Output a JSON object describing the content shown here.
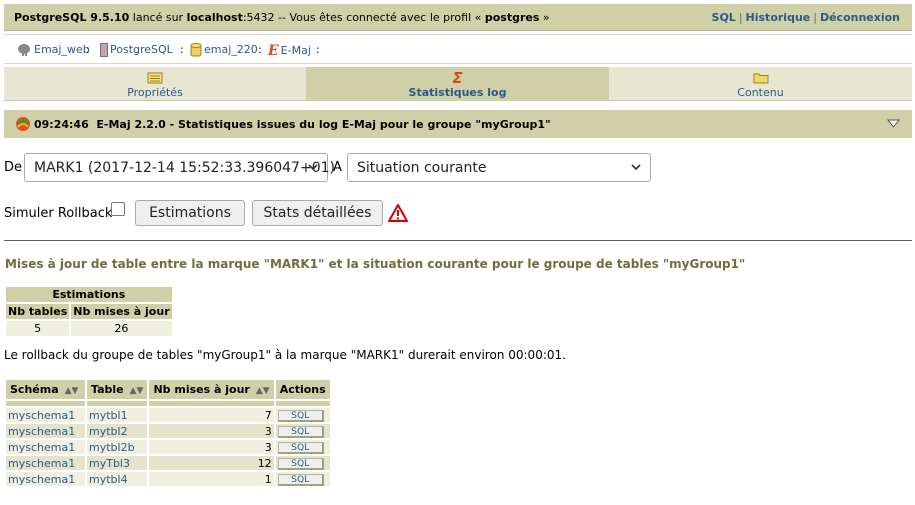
{
  "topbar": {
    "server_name": "PostgreSQL 9.5.10",
    "launched_on": " lancé sur ",
    "host": "localhost",
    "port_msg": ":5432 -- Vous êtes connecté avec le profil « ",
    "profile": "postgres",
    "close_quote": " »",
    "links": {
      "sql": "SQL",
      "history": "Historique",
      "logout": "Déconnexion"
    }
  },
  "breadcrumb": {
    "server": "Emaj_web",
    "engine": "PostgreSQL",
    "database": "emaj_220",
    "plugin": "E-Maj",
    "sep": ":"
  },
  "tabs": [
    {
      "label": "Propriétés"
    },
    {
      "label": "Statistiques log"
    },
    {
      "label": "Contenu"
    }
  ],
  "title": {
    "time": "09:24:46",
    "text": "E-Maj 2.2.0  -  Statistiques issues du log E-Maj pour le groupe \"myGroup1\""
  },
  "form": {
    "from_label": "De",
    "from_value": "MARK1 (2017-12-14 15:52:33.396047+01)",
    "to_label": "A",
    "to_value": "Situation courante",
    "simulate_label": "Simuler Rollback",
    "estimations_label": "Estimations",
    "detailed_label": "Stats détaillées"
  },
  "section_title": "Mises à jour de table entre la marque \"MARK1\" et la situation courante pour le groupe de tables \"myGroup1\"",
  "estimations_table": {
    "caption": "Estimations",
    "headers": [
      "Nb tables",
      "Nb mises à jour"
    ],
    "values": [
      "5",
      "26"
    ]
  },
  "rollback_message": "Le rollback du groupe de tables \"myGroup1\" à la marque \"MARK1\" durerait environ 00:00:01.",
  "stats_table": {
    "headers": [
      "Schéma",
      "Table",
      "Nb mises à jour",
      "Actions"
    ],
    "sort_icon": "sort-icon",
    "rows": [
      {
        "schema": "myschema1",
        "table": "mytbl1",
        "count": "7",
        "action": "SQL"
      },
      {
        "schema": "myschema1",
        "table": "mytbl2",
        "count": "3",
        "action": "SQL"
      },
      {
        "schema": "myschema1",
        "table": "mytbl2b",
        "count": "3",
        "action": "SQL"
      },
      {
        "schema": "myschema1",
        "table": "myTbl3",
        "count": "12",
        "action": "SQL"
      },
      {
        "schema": "myschema1",
        "table": "mytbl4",
        "count": "1",
        "action": "SQL"
      }
    ]
  },
  "colors": {
    "bar": "#d0d0a8",
    "link": "#2b5a87",
    "section_title": "#716d3c",
    "warning": "#cc0000"
  }
}
